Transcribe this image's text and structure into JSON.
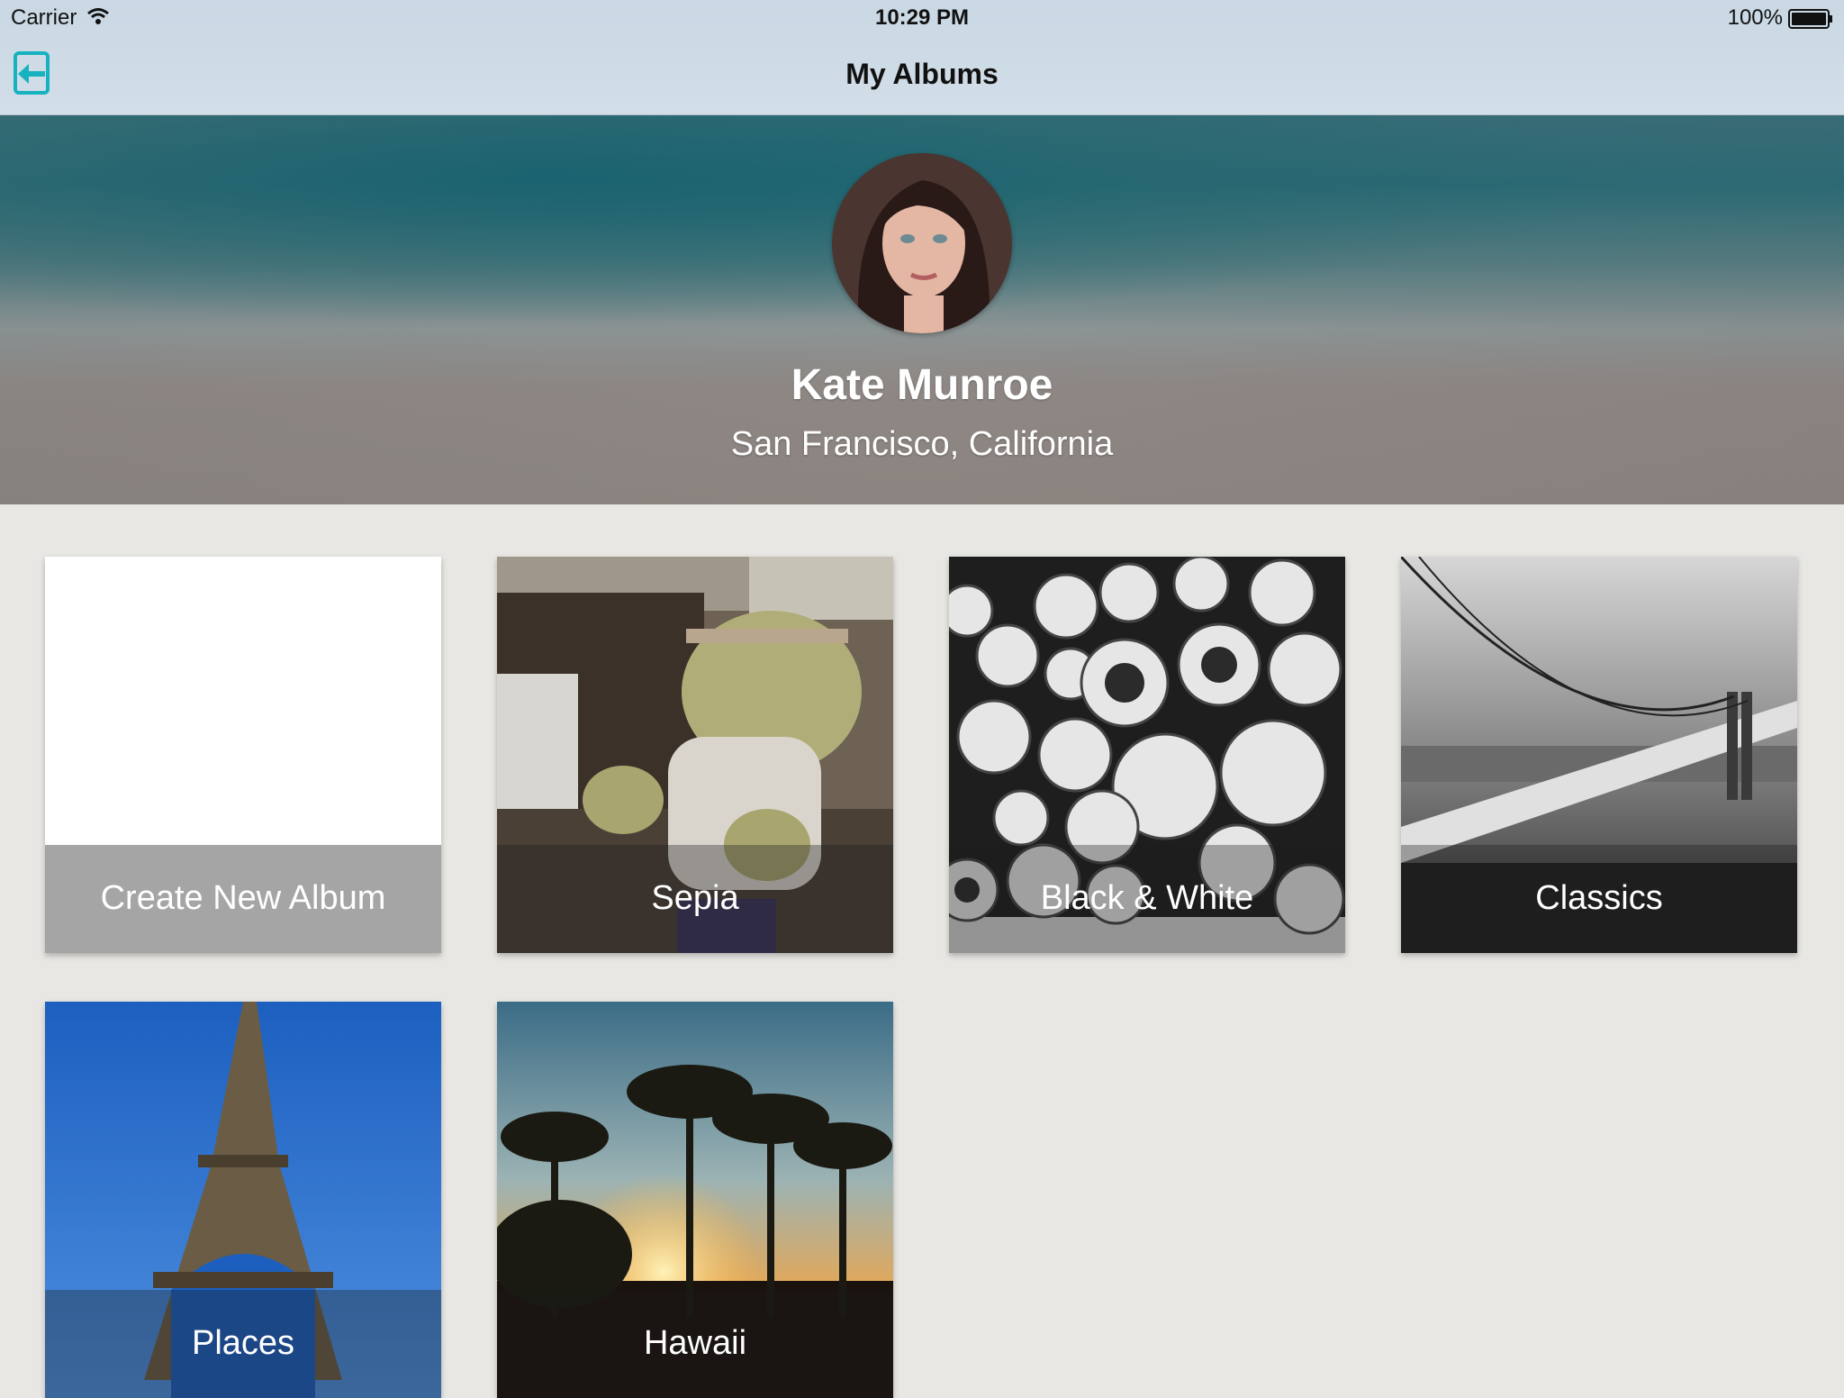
{
  "status_bar": {
    "carrier": "Carrier",
    "time": "10:29 PM",
    "battery": "100%"
  },
  "nav": {
    "title": "My Albums",
    "logout_icon": "logout-icon"
  },
  "profile": {
    "name": "Kate Munroe",
    "location": "San Francisco, California"
  },
  "albums": [
    {
      "label": "Create New Album"
    },
    {
      "label": "Sepia"
    },
    {
      "label": "Black & White"
    },
    {
      "label": "Classics"
    },
    {
      "label": "Places"
    },
    {
      "label": "Hawaii"
    }
  ],
  "colors": {
    "accent": "#17b2c0",
    "background": "#e8e7e3",
    "caption_overlay": "#a5a5a5"
  }
}
